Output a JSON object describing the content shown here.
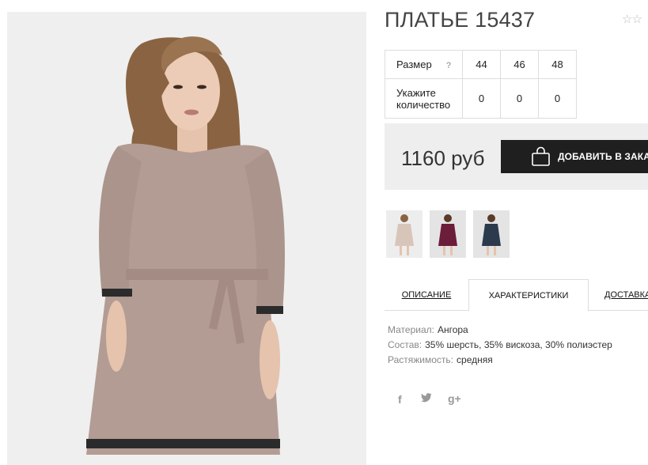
{
  "product": {
    "title": "ПЛАТЬЕ 15437",
    "rating_stars": "☆☆"
  },
  "size_table": {
    "size_label": "Размер",
    "help": "?",
    "sizes": [
      "44",
      "46",
      "48"
    ],
    "qty_label": "Укажите количество",
    "quantities": [
      "0",
      "0",
      "0"
    ]
  },
  "purchase": {
    "price": "1160 руб",
    "add_button": "ДОБАВИТЬ В ЗАКАЗ",
    "button_icon": "shopping-bag-icon"
  },
  "thumbnails": [
    {
      "dress_color": "#d8c5ba"
    },
    {
      "dress_color": "#6b1d3a"
    },
    {
      "dress_color": "#2c3a4e"
    }
  ],
  "tabs": [
    {
      "label": "ОПИСАНИЕ",
      "active": false
    },
    {
      "label": "ХАРАКТЕРИСТИКИ",
      "active": true
    },
    {
      "label": "ДОСТАВКА",
      "active": false
    }
  ],
  "specs": [
    {
      "key": "Материал:",
      "value": "Ангора"
    },
    {
      "key": "Состав:",
      "value": "35% шерсть, 35% вискоза, 30% полиэстер"
    },
    {
      "key": "Растяжимость:",
      "value": "средняя"
    }
  ],
  "social": [
    {
      "icon": "facebook-icon",
      "glyph": "f"
    },
    {
      "icon": "twitter-icon",
      "glyph": "🐦"
    },
    {
      "icon": "google-plus-icon",
      "glyph": "g+"
    }
  ],
  "colors": {
    "button_bg": "#1f1f1f",
    "price_box_bg": "#eeeeee",
    "dress": "#b39c94"
  }
}
